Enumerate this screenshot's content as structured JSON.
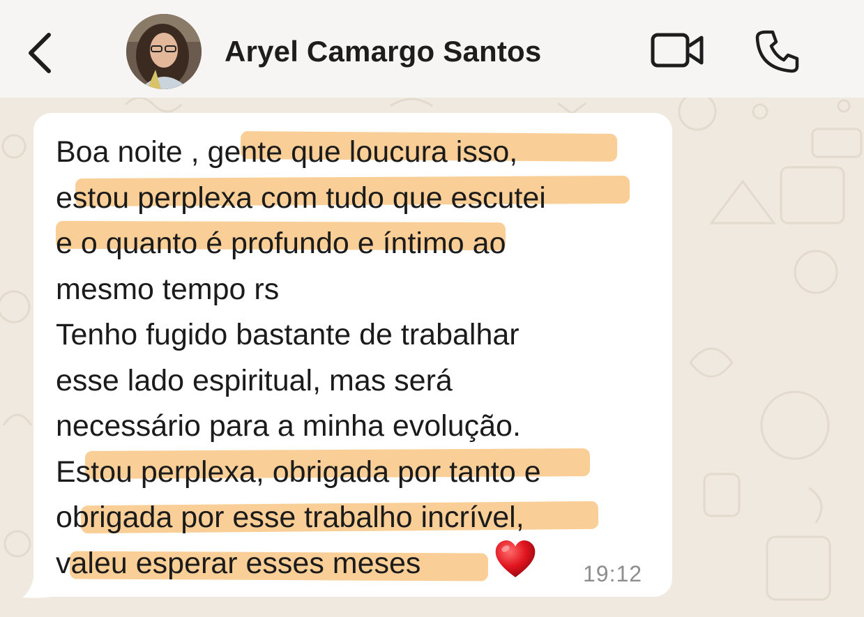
{
  "header": {
    "back_icon": "chevron-left-icon",
    "contact_name": "Aryel Camargo Santos",
    "video_icon": "video-camera-icon",
    "call_icon": "phone-icon"
  },
  "message": {
    "lines": [
      "Boa noite , gente que loucura isso,",
      "estou perplexa com tudo que escutei",
      "e o quanto é profundo e íntimo ao",
      "mesmo tempo rs",
      "Tenho fugido bastante de trabalhar",
      "esse lado espiritual, mas será",
      "necessário para a minha evolução.",
      "Estou perplexa, obrigada por tanto e",
      "obrigada por esse trabalho incrível,",
      "valeu esperar esses meses"
    ],
    "emoji": "red-heart-icon",
    "time": "19:12"
  },
  "colors": {
    "background": "#efe9df",
    "header": "#f6f5f3",
    "bubble": "#ffffff",
    "highlight": "#f7c27a",
    "timestamp": "#8d8d8d"
  }
}
